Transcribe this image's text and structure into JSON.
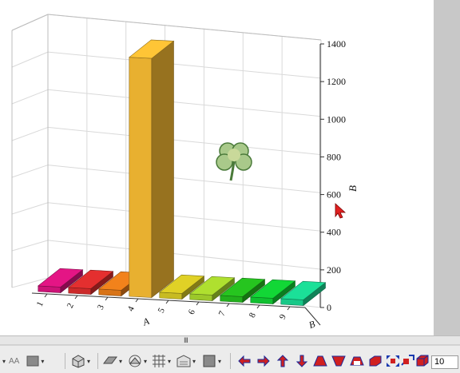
{
  "chart_data": {
    "type": "bar",
    "subtype": "3d-column",
    "categories": [
      "1",
      "2",
      "3",
      "4",
      "5",
      "6",
      "7",
      "8",
      "9"
    ],
    "values": [
      30,
      30,
      30,
      1270,
      30,
      30,
      30,
      30,
      30
    ],
    "colors": [
      "#cc1377",
      "#cc2a2a",
      "#d87418",
      "#e8b030",
      "#c8bb22",
      "#9cc82a",
      "#22b01c",
      "#10c030",
      "#18c888"
    ],
    "xlabel": "A",
    "ylabel": "",
    "zlabel": "B",
    "zlim": [
      0,
      1400
    ],
    "z_ticks": [
      "0",
      "200",
      "400",
      "600",
      "800",
      "1000",
      "1200",
      "1400"
    ],
    "y_axis_partial_ticks": [
      "B"
    ],
    "grid": true
  },
  "toolbar": {
    "zoom_value": "10",
    "partial_left_label": "AA"
  },
  "splitter": {
    "grip": "III"
  },
  "icons": {
    "watermark": "clover-icon",
    "cursor": "mouse-pointer-icon"
  }
}
